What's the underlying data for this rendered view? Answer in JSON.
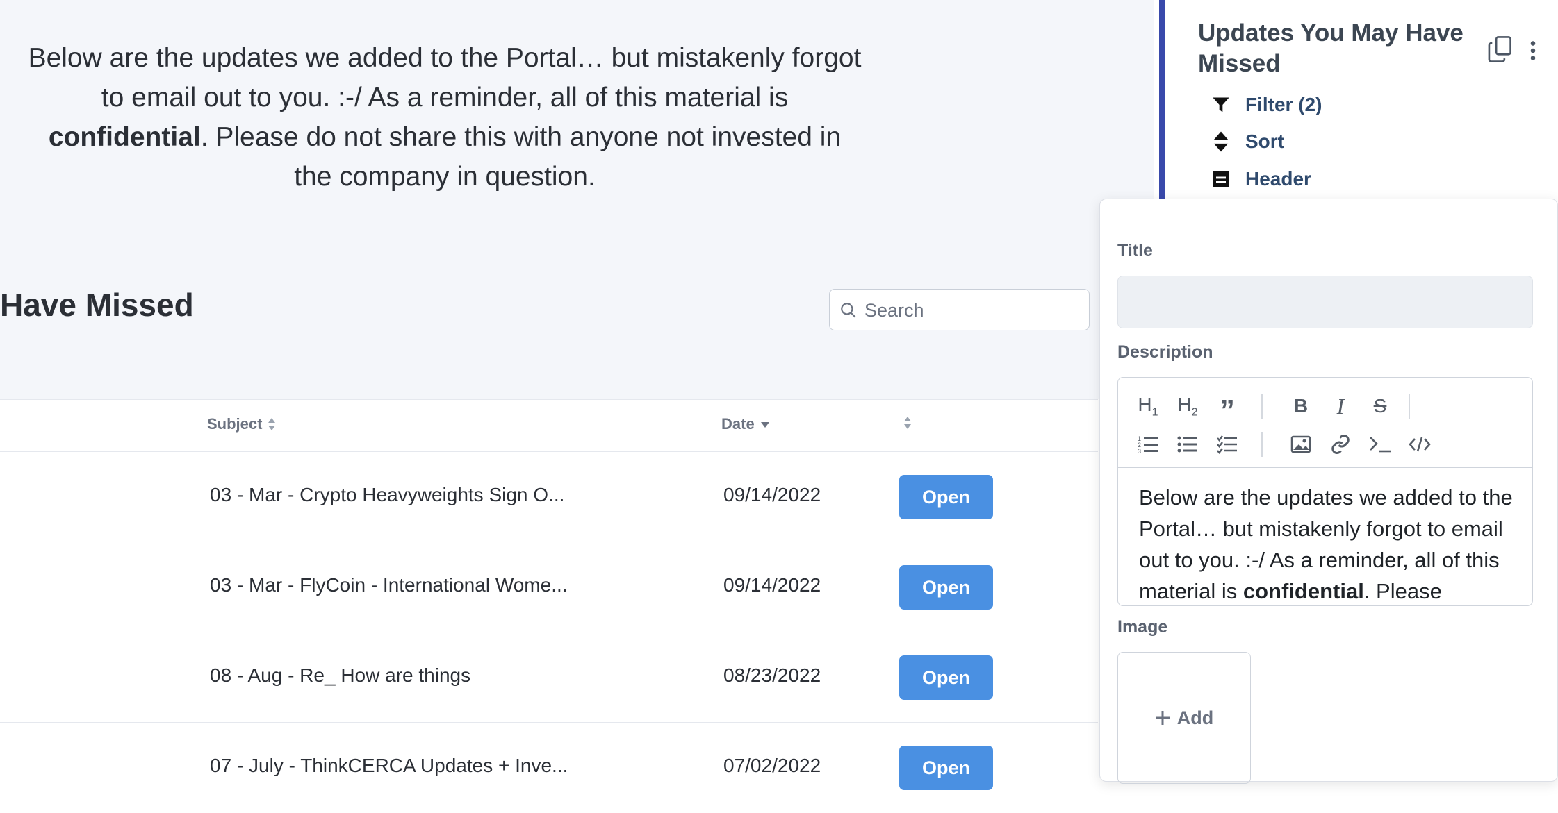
{
  "intro": {
    "part1": "Below are the updates we added to the Portal… but mistakenly forgot to email out to you. :-/ As a reminder, all of this material is ",
    "bold": "confidential",
    "part2": ". Please do not share this with anyone not invested in the company in question."
  },
  "section": {
    "title": "Have Missed"
  },
  "search": {
    "placeholder": "Search",
    "icon": "search-icon"
  },
  "table": {
    "columns": {
      "subject": "Subject",
      "date": "Date"
    },
    "rows": [
      {
        "subject": "03 - Mar - Crypto Heavyweights Sign O...",
        "date": "09/14/2022",
        "action": "Open"
      },
      {
        "subject": "03 - Mar - FlyCoin - International Wome...",
        "date": "09/14/2022",
        "action": "Open"
      },
      {
        "subject": "08 - Aug - Re_ How are things",
        "date": "08/23/2022",
        "action": "Open"
      },
      {
        "subject": "07 - July - ThinkCERCA Updates + Inve...",
        "date": "07/02/2022",
        "action": "Open"
      }
    ]
  },
  "sidebar": {
    "title": "Updates You May Have Missed",
    "items": [
      {
        "label": "Filter (2)",
        "icon": "filter-icon"
      },
      {
        "label": "Sort",
        "icon": "sort-icon"
      },
      {
        "label": "Header",
        "icon": "header-icon"
      }
    ],
    "accent": "#3949ab"
  },
  "popover": {
    "title_label": "Title",
    "title_value": "",
    "description_label": "Description",
    "description": {
      "part1": "Below are the updates we added to the Portal… but mistakenly forgot to email out to you. :-/ As a reminder, all of this material is ",
      "bold": "confidential",
      "part2": ". Please"
    },
    "image_label": "Image",
    "add_label": "Add",
    "toolbar": [
      "heading-1-icon",
      "heading-2-icon",
      "quote-icon",
      "bold-icon",
      "italic-icon",
      "strikethrough-icon",
      "ordered-list-icon",
      "bullet-list-icon",
      "checklist-icon",
      "image-icon",
      "link-icon",
      "code-icon",
      "code-block-icon"
    ]
  },
  "colors": {
    "button": "#4a90e2",
    "page_bg": "#f4f6fa"
  }
}
